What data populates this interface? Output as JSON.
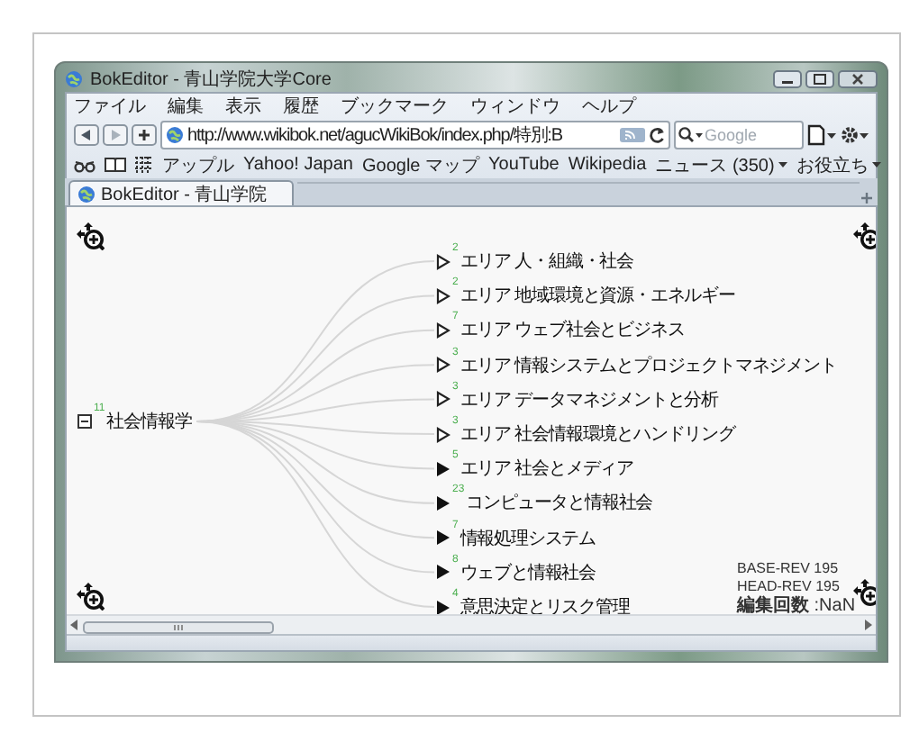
{
  "window": {
    "title": "BokEditor - 青山学院大学Core"
  },
  "menu": [
    "ファイル",
    "編集",
    "表示",
    "履歴",
    "ブックマーク",
    "ウィンドウ",
    "ヘルプ"
  ],
  "address_bar": {
    "url": "http://www.wikibok.net/agucWikiBok/index.php/特別:B"
  },
  "search": {
    "placeholder": "Google"
  },
  "bookmarks": [
    {
      "label": "アップル",
      "menu": false
    },
    {
      "label": "Yahoo! Japan",
      "menu": false
    },
    {
      "label": "Google マップ",
      "menu": false
    },
    {
      "label": "YouTube",
      "menu": false
    },
    {
      "label": "Wikipedia",
      "menu": false
    },
    {
      "label": "ニュース (350)",
      "menu": true
    },
    {
      "label": "お役立ち",
      "menu": true
    }
  ],
  "tabs": [
    {
      "label": "BokEditor - 青山学院",
      "selected": true
    }
  ],
  "tree": {
    "root": {
      "label": "社会情報学",
      "count": "11",
      "expanded": true,
      "children": [
        {
          "kind": "area",
          "count": "2",
          "label": "エリア 人・組織・社会"
        },
        {
          "kind": "area",
          "count": "2",
          "label": "エリア 地域環境と資源・エネルギー"
        },
        {
          "kind": "area",
          "count": "7",
          "label": "エリア ウェブ社会とビジネス"
        },
        {
          "kind": "area",
          "count": "3",
          "label": "エリア 情報システムとプロジェクトマネジメント"
        },
        {
          "kind": "area",
          "count": "3",
          "label": "エリア データマネジメントと分析"
        },
        {
          "kind": "area",
          "count": "3",
          "label": "エリア 社会情報環境とハンドリング"
        },
        {
          "kind": "topic",
          "count": "5",
          "label": "エリア 社会とメディア"
        },
        {
          "kind": "topic",
          "count": "23",
          "label": "コンピュータと情報社会"
        },
        {
          "kind": "topic",
          "count": "7",
          "label": "情報処理システム"
        },
        {
          "kind": "topic",
          "count": "8",
          "label": "ウェブと情報社会"
        },
        {
          "kind": "topic",
          "count": "4",
          "label": "意思決定とリスク管理"
        }
      ]
    }
  },
  "revision": {
    "base": "BASE-REV 195",
    "head": "HEAD-REV 195",
    "edit_count": "**編集回数** :NaN"
  }
}
